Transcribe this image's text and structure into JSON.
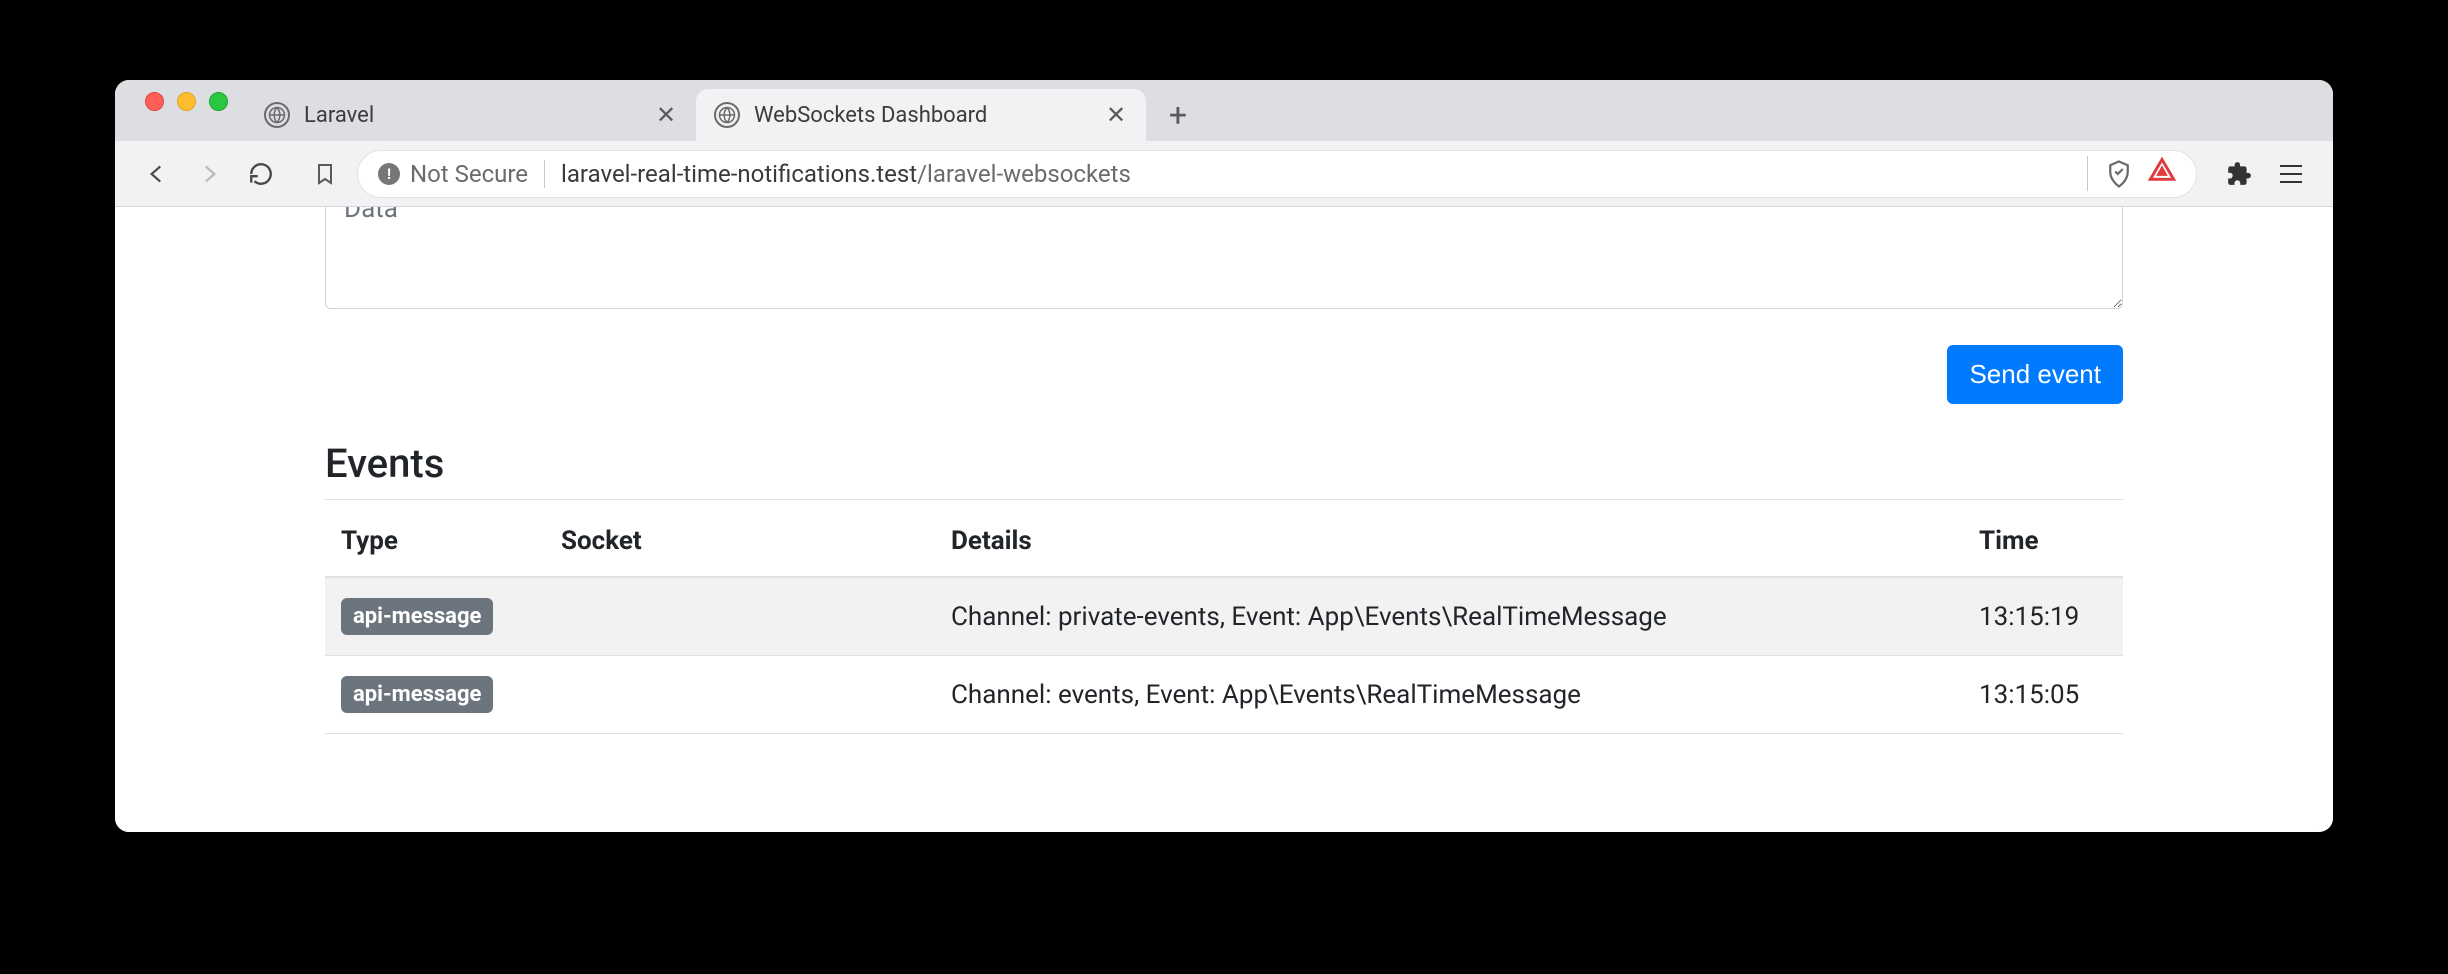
{
  "browser": {
    "tabs": [
      {
        "title": "Laravel",
        "active": false
      },
      {
        "title": "WebSockets Dashboard",
        "active": true
      }
    ],
    "security_label": "Not Secure",
    "url_host": "laravel-real-time-notifications.test",
    "url_path": "/laravel-websockets"
  },
  "form": {
    "data_placeholder": "Data",
    "send_button_label": "Send event"
  },
  "events": {
    "heading": "Events",
    "columns": {
      "type": "Type",
      "socket": "Socket",
      "details": "Details",
      "time": "Time"
    },
    "rows": [
      {
        "type_badge": "api-message",
        "socket": "",
        "details": "Channel: private-events, Event: App\\Events\\RealTimeMessage",
        "time": "13:15:19"
      },
      {
        "type_badge": "api-message",
        "socket": "",
        "details": "Channel: events, Event: App\\Events\\RealTimeMessage",
        "time": "13:15:05"
      }
    ]
  }
}
